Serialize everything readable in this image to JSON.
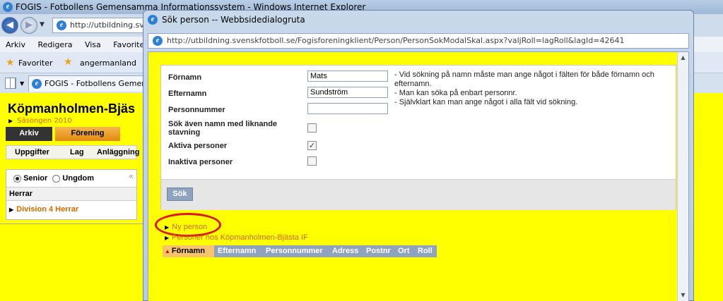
{
  "background_window": {
    "title": "FOGIS - Fotbollens Gemensamma Informationssystem - Windows Internet Explorer",
    "address": "http://utbildning.sve",
    "menu": [
      "Arkiv",
      "Redigera",
      "Visa",
      "Favoriter"
    ],
    "favorites_label": "Favoriter",
    "favorites_link": "angermanland",
    "tab_title": "FOGIS - Fotbollens Gemen..."
  },
  "page": {
    "club_title": "Köpmanholmen-Bjäs",
    "season": "Säsongen 2010",
    "main_tabs": [
      {
        "label": "Arkiv",
        "active": false
      },
      {
        "label": "Förening",
        "active": true
      }
    ],
    "sub_nav": [
      "Uppgifter",
      "Lag",
      "Anläggning"
    ],
    "radio_senior": "Senior",
    "radio_ungdom": "Ungdom",
    "collapse_symbol": "«",
    "group_header": "Herrar",
    "division_link": "Division 4 Herrar"
  },
  "dialog": {
    "title": "Sök person -- Webbsidedialogruta",
    "address": "http://utbildning.svenskfotboll.se/Fogisforeningklient/Person/PersonSokModalSkal.aspx?valjRoll=lagRoll&lagId=42641",
    "form": {
      "fornamn_label": "Förnamn",
      "fornamn_value": "Mats",
      "efternamn_label": "Efternamn",
      "efternamn_value": "Sundström",
      "personnummer_label": "Personnummer",
      "personnummer_value": "",
      "liknande_label_1": "Sök även namn med liknande",
      "liknande_label_2": "stavning",
      "liknande_checked": false,
      "aktiva_label": "Aktiva personer",
      "aktiva_checked": true,
      "inaktiva_label": "Inaktiva personer",
      "inaktiva_checked": false,
      "help_lines": [
        "- Vid sökning på namn måste man ange något i fälten för både förnamn och efternamn.",
        "- Man kan söka på enbart personnr.",
        "- Självklart kan man ange något i alla fält vid sökning."
      ],
      "search_button": "Sök"
    },
    "new_person_link": "Ny person",
    "club_persons_link": "Personer hos Köpmanholmen-Bjästa IF",
    "results_columns": [
      "Förnamn",
      "Efternamn",
      "Personnummer",
      "Adress",
      "Postnr",
      "Ort",
      "Roll"
    ],
    "active_sort_column": "Förnamn"
  }
}
